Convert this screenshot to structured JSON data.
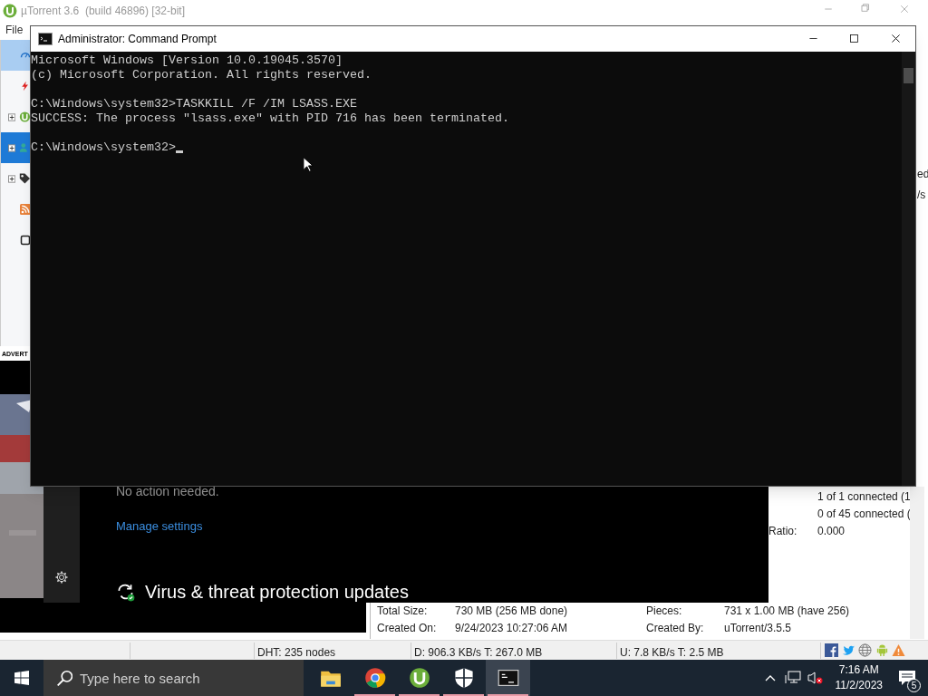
{
  "utorrent": {
    "title": "µTorrent 3.6  (build 46896) [32-bit]",
    "menu": [
      "File"
    ],
    "sidebar": [
      {
        "kind": "speed",
        "selected": true
      },
      {
        "kind": "bolt",
        "selected": false
      },
      {
        "kind": "torrent",
        "selected": false
      },
      {
        "kind": "peers",
        "selected": true
      },
      {
        "kind": "tag",
        "selected": false
      },
      {
        "kind": "rss",
        "selected": false
      },
      {
        "kind": "device",
        "selected": false
      }
    ],
    "advert_label": "ADVERT",
    "list_fragments": [
      "ed",
      "/s"
    ],
    "transfer": [
      {
        "value": "1 of 1 connected (1"
      },
      {
        "value": "0 of 45 connected ("
      },
      {
        "label": "Ratio:",
        "value": "0.000"
      }
    ],
    "general": [
      {
        "label": "Total Size:",
        "value": "730 MB (256 MB done)",
        "label_2": "Pieces:",
        "value_2": "731 x 1.00 MB (have 256)"
      },
      {
        "label": "Created On:",
        "value": "9/24/2023 10:27:06 AM",
        "label_2": "Created By:",
        "value_2": "uTorrent/3.5.5"
      }
    ],
    "status_bar": [
      "DHT: 235 nodes",
      "D: 906.3 KB/s T: 267.0 MB",
      "U: 7.8 KB/s T: 2.5 MB"
    ]
  },
  "defender": {
    "status": "No action needed.",
    "link": "Manage settings",
    "section_title": "Virus & threat protection updates"
  },
  "console": {
    "title": "Administrator: Command Prompt",
    "blocks": [
      [
        "Microsoft Windows [Version 10.0.19045.3570]",
        "(c) Microsoft Corporation. All rights reserved."
      ],
      [
        "C:\\Windows\\system32>TASKKILL /F /IM LSASS.EXE",
        "SUCCESS: The process \"lsass.exe\" with PID 716 has been terminated."
      ],
      [
        "C:\\Windows\\system32>"
      ]
    ]
  },
  "taskbar": {
    "search_placeholder": "Type here to search",
    "apps": [
      {
        "kind": "folder",
        "running": false,
        "selected": false
      },
      {
        "kind": "chrome",
        "running": true,
        "selected": false
      },
      {
        "kind": "utorrent",
        "running": true,
        "selected": false
      },
      {
        "kind": "shield",
        "running": true,
        "selected": false
      },
      {
        "kind": "console",
        "running": true,
        "selected": true
      }
    ],
    "time": "7:16 AM",
    "date": "11/2/2023",
    "notification_count": "5"
  }
}
